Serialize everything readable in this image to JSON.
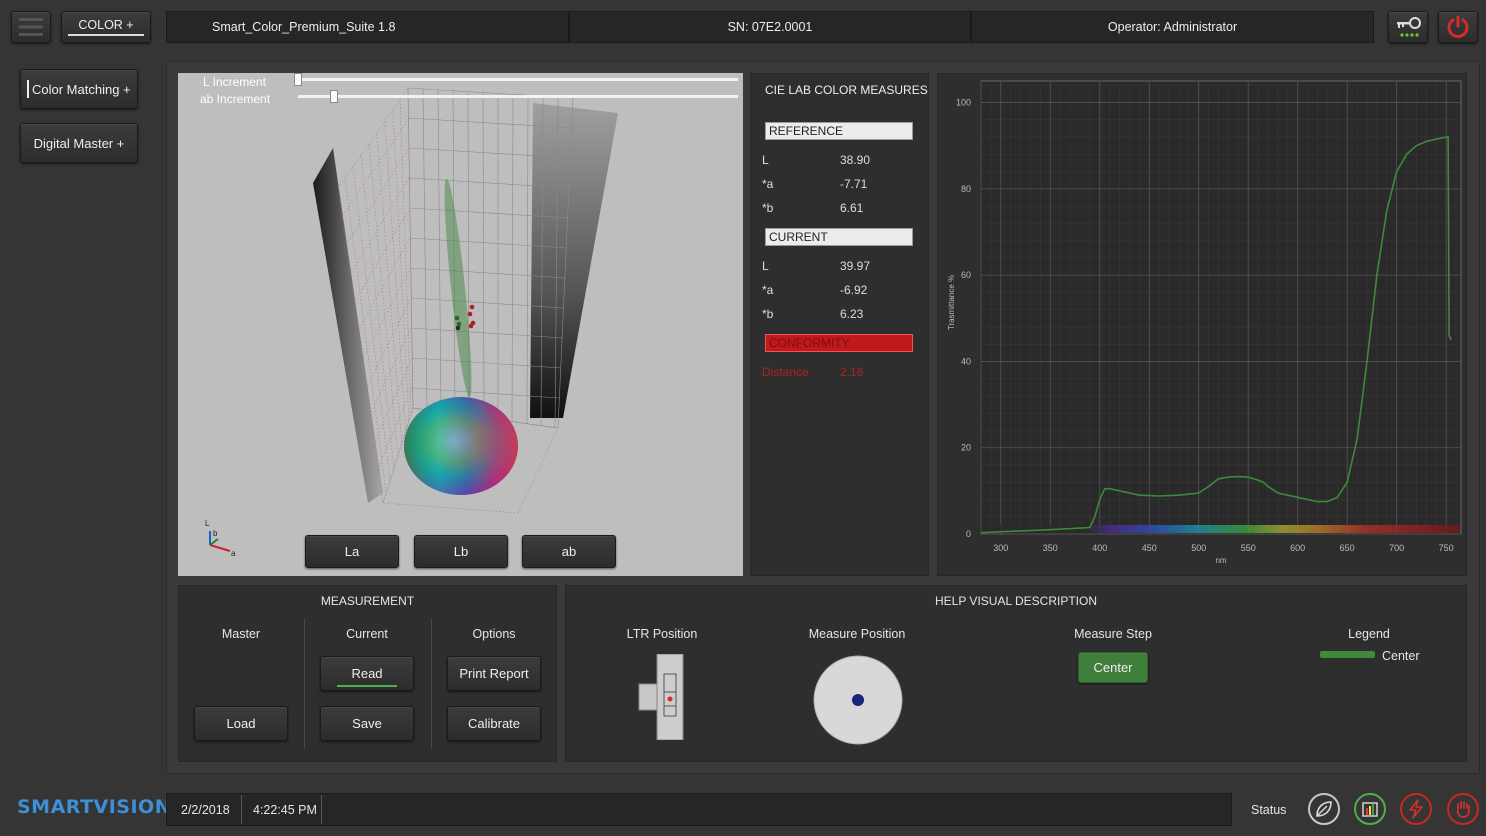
{
  "header": {
    "menu_icon": "hamburger-icon",
    "color_tab": "COLOR +",
    "app_name": "Smart_Color_Premium_Suite 1.8",
    "serial": "SN: 07E2.0001",
    "operator": "Operator: Administrator",
    "key_icon": "key-icon",
    "power_icon": "power-icon"
  },
  "sidebar": {
    "items": [
      {
        "label": "Color Matching +"
      },
      {
        "label": "Digital Master +"
      }
    ]
  },
  "viewer": {
    "l_increment_label": "L Increment",
    "ab_increment_label": "ab Increment",
    "l_increment_level": 0.0,
    "ab_increment_level": 0.08,
    "view_buttons": [
      "La",
      "Lb",
      "ab"
    ],
    "axis_labels": {
      "l": "L",
      "b": "b",
      "a": "a"
    }
  },
  "lab": {
    "title": "CIE LAB COLOR MEASURES",
    "reference_label": "REFERENCE",
    "reference": [
      {
        "k": "L",
        "v": "38.90"
      },
      {
        "k": "*a",
        "v": "-7.71"
      },
      {
        "k": "*b",
        "v": "6.61"
      }
    ],
    "current_label": "CURRENT",
    "current": [
      {
        "k": "L",
        "v": "39.97"
      },
      {
        "k": "*a",
        "v": "-6.92"
      },
      {
        "k": "*b",
        "v": "6.23"
      }
    ],
    "conformity_label": "CONFORMITY",
    "distance_label": "Distance",
    "distance_value": "2.16",
    "conformity_color": "#c0181c"
  },
  "chart_data": {
    "type": "line",
    "xlabel": "nm",
    "ylabel": "Trasmittance %",
    "xlim": [
      280,
      765
    ],
    "ylim": [
      0,
      105
    ],
    "xticks": [
      "300",
      "350",
      "400",
      "450",
      "500",
      "550",
      "600",
      "650",
      "700",
      "750"
    ],
    "yticks": [
      "0",
      "20",
      "40",
      "60",
      "80",
      "100"
    ],
    "grid": true,
    "series": [
      {
        "color": "#3e8a3a",
        "x": [
          280,
          300,
          350,
          390,
          395,
          400,
          405,
          410,
          420,
          440,
          460,
          480,
          500,
          510,
          520,
          530,
          540,
          550,
          560,
          565,
          570,
          580,
          590,
          600,
          610,
          620,
          630,
          640,
          650,
          660,
          670,
          680,
          690,
          700,
          710,
          720,
          730,
          740,
          750,
          752,
          753,
          755
        ],
        "y": [
          0.3,
          0.5,
          1.0,
          1.5,
          4,
          8,
          10.5,
          10.5,
          10,
          9,
          8.8,
          9,
          9.5,
          11,
          12.8,
          13.2,
          13.3,
          13.2,
          12.5,
          12,
          11,
          9.5,
          9,
          8.5,
          8,
          7.5,
          7.5,
          8.5,
          12,
          22,
          40,
          60,
          75,
          84,
          88,
          90,
          91,
          91.5,
          92,
          92,
          46,
          45
        ]
      }
    ]
  },
  "measurement": {
    "title": "MEASUREMENT",
    "columns": [
      "Master",
      "Current",
      "Options"
    ],
    "read": "Read",
    "print_report": "Print Report",
    "load": "Load",
    "save": "Save",
    "calibrate": "Calibrate"
  },
  "help": {
    "title": "HELP VISUAL DESCRIPTION",
    "ltr_position": "LTR Position",
    "measure_position": "Measure Position",
    "measure_step": "Measure Step",
    "center_button": "Center",
    "legend_title": "Legend",
    "legend_item": "Center",
    "legend_color": "#3e8a3a"
  },
  "footer": {
    "brand": "SMARTVISION",
    "date": "2/2/2018",
    "time": "4:22:45 PM",
    "status_label": "Status",
    "status_icons": [
      "leaf-icon",
      "chart-icon",
      "lightning-icon",
      "hand-icon"
    ]
  }
}
